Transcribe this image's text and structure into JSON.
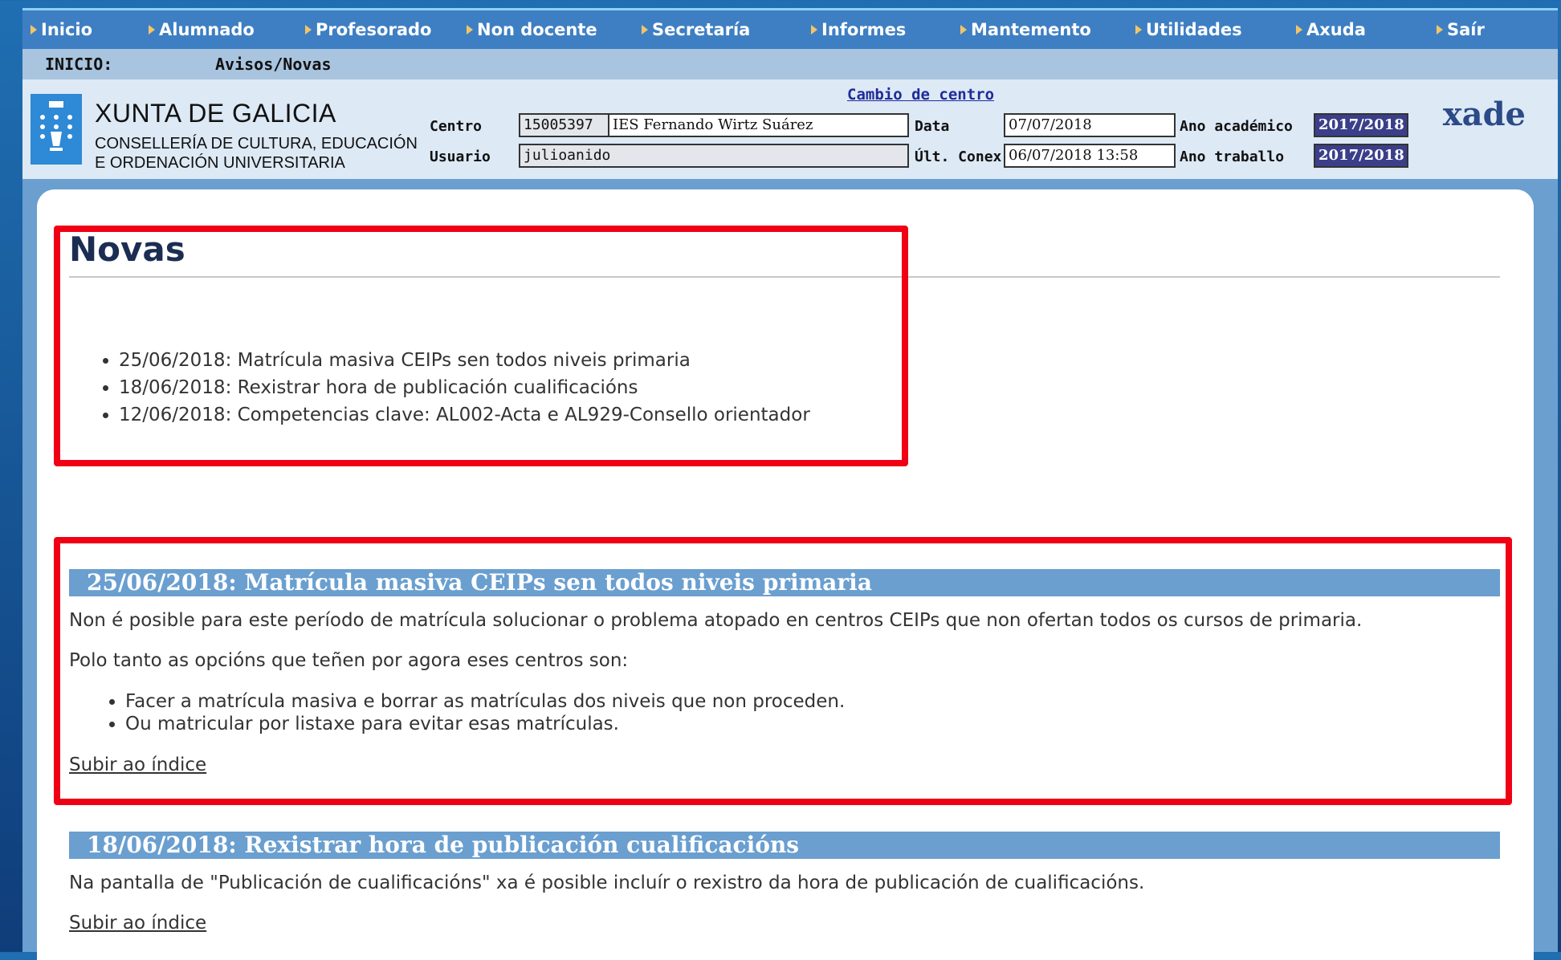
{
  "menu": {
    "items": [
      {
        "label": "Inicio"
      },
      {
        "label": "Alumnado"
      },
      {
        "label": "Profesorado"
      },
      {
        "label": "Non docente"
      },
      {
        "label": "Secretaría"
      },
      {
        "label": "Informes"
      },
      {
        "label": "Mantemento"
      },
      {
        "label": "Utilidades"
      },
      {
        "label": "Axuda"
      },
      {
        "label": "Saír"
      }
    ]
  },
  "breadcrumb": {
    "section": "INICIO:",
    "page": "Avisos/Novas"
  },
  "header": {
    "org_name": "XUNTA DE GALICIA",
    "dept_line1": "CONSELLERÍA DE CULTURA, EDUCACIÓN",
    "dept_line2": "E ORDENACIÓN UNIVERSITARIA",
    "change_center_link": "Cambio de centro",
    "brand": "xade",
    "centro_label": "Centro",
    "centro_code": "15005397",
    "centro_name": "IES Fernando Wirtz Suárez",
    "usuario_label": "Usuario",
    "usuario_value": "julioanido",
    "data_label": "Data",
    "data_value": "07/07/2018",
    "ult_conex_label": "Últ. Conex",
    "ult_conex_value": "06/07/2018 13:58",
    "ano_academico_label": "Ano académico",
    "ano_academico_value": "2017/2018",
    "ano_traballo_label": "Ano traballo",
    "ano_traballo_value": "2017/2018"
  },
  "content": {
    "title": "Novas",
    "index": [
      "25/06/2018: Matrícula masiva CEIPs sen todos niveis primaria",
      "18/06/2018: Rexistrar hora de publicación cualificacións",
      "12/06/2018: Competencias clave: AL002-Acta e AL929-Consello orientador"
    ],
    "sections": [
      {
        "heading": "25/06/2018: Matrícula masiva CEIPs sen todos niveis primaria",
        "para1": "Non é posible para este período de matrícula solucionar o problema atopado en centros CEIPs que non ofertan todos os cursos de primaria.",
        "para2": "Polo tanto as opcións que teñen por agora eses centros son:",
        "bullets": [
          "Facer a matrícula masiva e borrar as matrículas dos niveis que non proceden.",
          "Ou matricular por listaxe para evitar esas matrículas."
        ],
        "up_link": "Subir ao índice"
      },
      {
        "heading": "18/06/2018: Rexistrar hora de publicación cualificacións",
        "para1": "Na pantalla de \"Publicación de cualificacións\" xa é posible incluír o rexistro da hora de publicación de cualificacións.",
        "up_link": "Subir ao índice"
      }
    ]
  },
  "colors": {
    "menu_bg": "#3e7fc3",
    "section_bar": "#6a9fd0",
    "highlight_box": "#f00014",
    "arrow": "#f3c567"
  }
}
